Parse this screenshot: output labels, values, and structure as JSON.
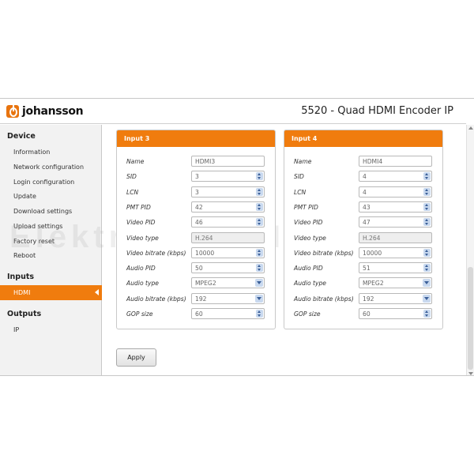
{
  "header": {
    "logo_text": "johansson",
    "title": "5520 - Quad HDMI Encoder IP"
  },
  "sidebar": {
    "sections": [
      {
        "title": "Device",
        "items": [
          "Information",
          "Network configuration",
          "Login configuration",
          "Update",
          "Download settings",
          "Upload settings",
          "Factory reset",
          "Reboot"
        ]
      },
      {
        "title": "Inputs",
        "items": [
          "HDMI"
        ],
        "active": "HDMI"
      },
      {
        "title": "Outputs",
        "items": [
          "IP"
        ]
      }
    ]
  },
  "watermark": "Elektro HERINK s.r.o.",
  "panels": [
    {
      "title": "Input 3",
      "fields": [
        {
          "label": "Name",
          "value": "HDMI3",
          "kind": "text"
        },
        {
          "label": "SID",
          "value": "3",
          "kind": "spin"
        },
        {
          "label": "LCN",
          "value": "3",
          "kind": "spin"
        },
        {
          "label": "PMT PID",
          "value": "42",
          "kind": "spin"
        },
        {
          "label": "Video PID",
          "value": "46",
          "kind": "spin"
        },
        {
          "label": "Video type",
          "value": "H.264",
          "kind": "readonly"
        },
        {
          "label": "Video bitrate (kbps)",
          "value": "10000",
          "kind": "spin"
        },
        {
          "label": "Audio PID",
          "value": "50",
          "kind": "spin"
        },
        {
          "label": "Audio type",
          "value": "MPEG2",
          "kind": "select"
        },
        {
          "label": "Audio bitrate (kbps)",
          "value": "192",
          "kind": "select"
        },
        {
          "label": "GOP size",
          "value": "60",
          "kind": "spin"
        }
      ]
    },
    {
      "title": "Input 4",
      "fields": [
        {
          "label": "Name",
          "value": "HDMI4",
          "kind": "text"
        },
        {
          "label": "SID",
          "value": "4",
          "kind": "spin"
        },
        {
          "label": "LCN",
          "value": "4",
          "kind": "spin"
        },
        {
          "label": "PMT PID",
          "value": "43",
          "kind": "spin"
        },
        {
          "label": "Video PID",
          "value": "47",
          "kind": "spin"
        },
        {
          "label": "Video type",
          "value": "H.264",
          "kind": "readonly"
        },
        {
          "label": "Video bitrate (kbps)",
          "value": "10000",
          "kind": "spin"
        },
        {
          "label": "Audio PID",
          "value": "51",
          "kind": "spin"
        },
        {
          "label": "Audio type",
          "value": "MPEG2",
          "kind": "select"
        },
        {
          "label": "Audio bitrate (kbps)",
          "value": "192",
          "kind": "select"
        },
        {
          "label": "GOP size",
          "value": "60",
          "kind": "spin"
        }
      ]
    }
  ],
  "apply_label": "Apply",
  "colors": {
    "accent": "#f07c0e",
    "spinner": "#c9d9ef"
  }
}
